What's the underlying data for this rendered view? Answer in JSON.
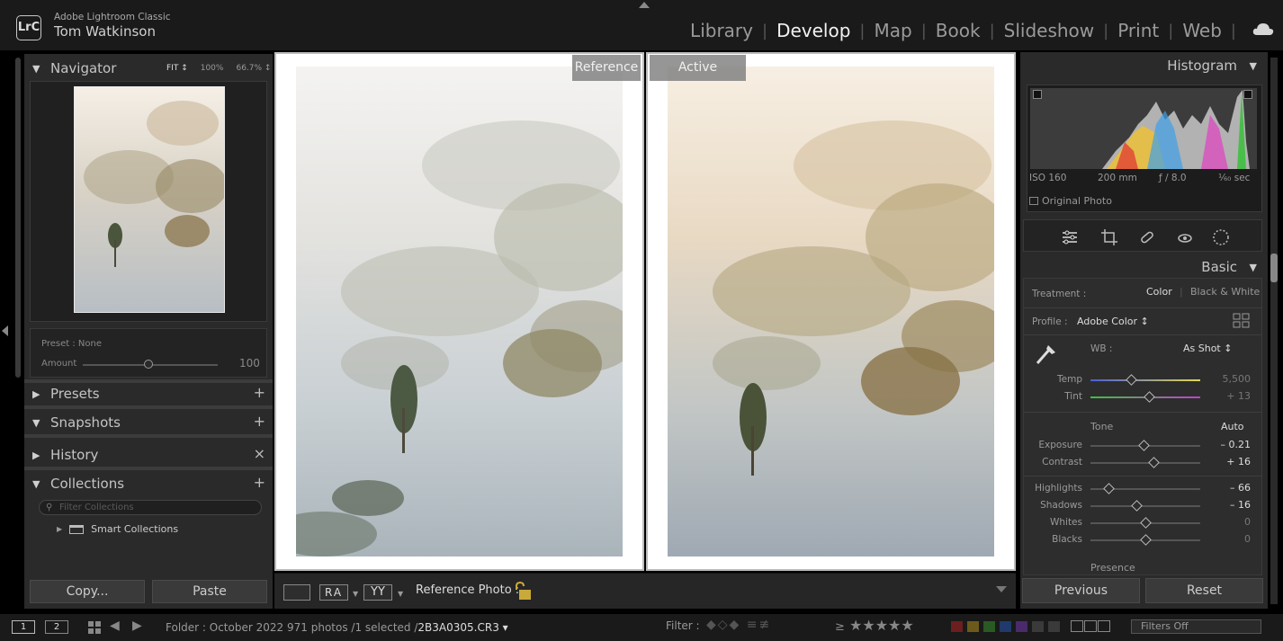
{
  "app": {
    "logo": "LrC",
    "name": "Adobe Lightroom Classic",
    "user": "Tom Watkinson"
  },
  "modules": [
    "Library",
    "Develop",
    "Map",
    "Book",
    "Slideshow",
    "Print",
    "Web"
  ],
  "active_module": "Develop",
  "left": {
    "navigator": {
      "title": "Navigator",
      "options": [
        "FIT ↕",
        "100%",
        "66.7% ↕"
      ]
    },
    "preset_amount": {
      "preset_label": "Preset : None",
      "amount_label": "Amount",
      "amount_value": "100"
    },
    "panels": {
      "presets": "Presets",
      "snapshots": "Snapshots",
      "history": "History",
      "collections": "Collections"
    },
    "collection_filter_placeholder": "Filter Collections",
    "smart_collections": "Smart Collections",
    "copy": "Copy...",
    "paste": "Paste"
  },
  "center": {
    "reference_tag": "Reference",
    "active_tag": "Active",
    "toolbar": {
      "ra": "RA",
      "yy": "YY",
      "reference_photo": "Reference Photo :"
    }
  },
  "right": {
    "histogram": {
      "title": "Histogram",
      "iso": "ISO 160",
      "focal": "200 mm",
      "aperture": "ƒ / 8.0",
      "shutter": "¹⁄₆₀ sec",
      "original_photo": "Original Photo"
    },
    "basic": {
      "title": "Basic",
      "treatment_label": "Treatment :",
      "treatment_color": "Color",
      "treatment_bw": "Black & White",
      "profile_label": "Profile :",
      "profile_value": "Adobe Color ↕",
      "wb_label": "WB :",
      "wb_value": "As Shot ↕",
      "tone_label": "Tone",
      "auto": "Auto",
      "presence_label": "Presence",
      "sliders": [
        {
          "label": "Temp",
          "value": "5,500",
          "pos": 0.37,
          "dim": true
        },
        {
          "label": "Tint",
          "value": "+ 13",
          "pos": 0.54,
          "dim": true
        },
        {
          "label": "Exposure",
          "value": "– 0.21",
          "pos": 0.49,
          "dim": false
        },
        {
          "label": "Contrast",
          "value": "+ 16",
          "pos": 0.58,
          "dim": false
        },
        {
          "label": "Highlights",
          "value": "– 66",
          "pos": 0.17,
          "dim": false
        },
        {
          "label": "Shadows",
          "value": "– 16",
          "pos": 0.42,
          "dim": false
        },
        {
          "label": "Whites",
          "value": "0",
          "pos": 0.5,
          "dim": true
        },
        {
          "label": "Blacks",
          "value": "0",
          "pos": 0.5,
          "dim": true
        }
      ]
    },
    "previous": "Previous",
    "reset": "Reset"
  },
  "filmstrip": {
    "view1": "1",
    "view2": "2",
    "folder": "Folder : October 2022",
    "count": "971 photos /1 selected /",
    "file": "2B3A0305.CR3 ▾",
    "filter_label": "Filter :",
    "stars_prefix": "≥",
    "stars": "★★★★★",
    "filters_off": "Filters Off",
    "label_colors": [
      "#6b1f1f",
      "#6b5a1a",
      "#2a5a23",
      "#1f3a6b",
      "#4a2a6b",
      "#3a3a3a",
      "#3a3a3a"
    ]
  }
}
